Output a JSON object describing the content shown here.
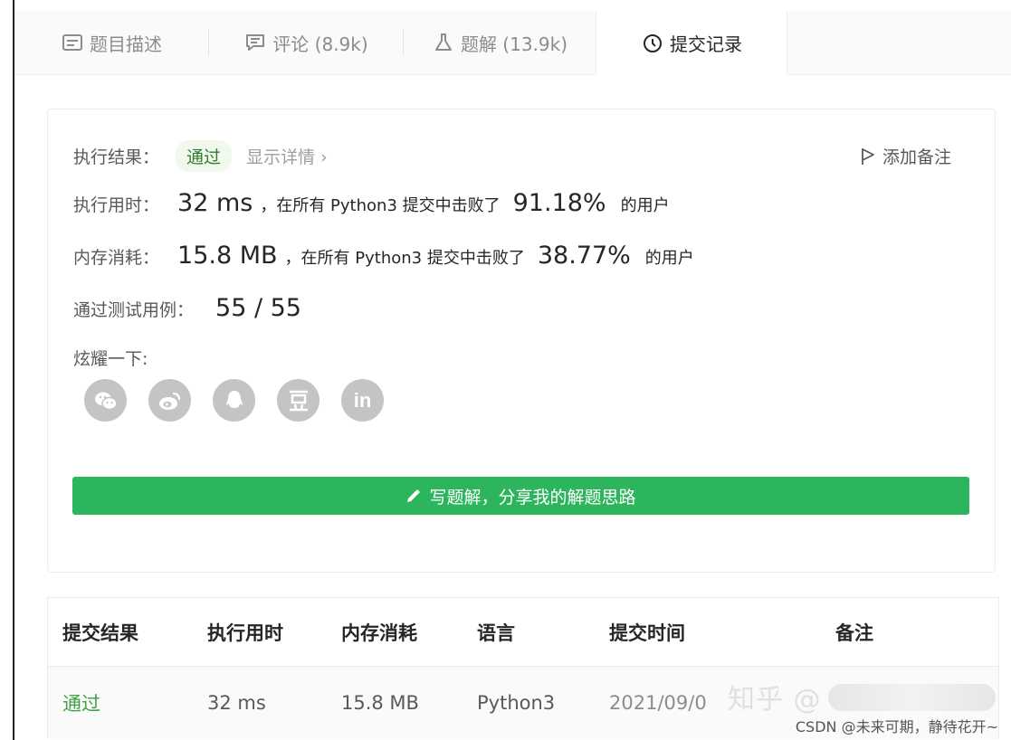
{
  "tabs": [
    {
      "label": "题目描述",
      "icon": "description-icon"
    },
    {
      "label": "评论 (8.9k)",
      "icon": "comment-icon"
    },
    {
      "label": "题解 (13.9k)",
      "icon": "flask-icon"
    },
    {
      "label": "提交记录",
      "icon": "clock-icon",
      "active": true
    }
  ],
  "result": {
    "status_label": "执行结果：",
    "status": "通过",
    "detail": "显示详情 ›",
    "add_note": "添加备注",
    "runtime_label": "执行用时：",
    "runtime": "32 ms",
    "runtime_text": "，在所有 Python3 提交中击败了",
    "runtime_pct": "91.18%",
    "users": "的用户",
    "memory_label": "内存消耗：",
    "memory": "15.8 MB",
    "memory_text": "，在所有 Python3 提交中击败了",
    "memory_pct": "38.77%",
    "tests_label": "通过测试用例：",
    "tests": "55 / 55",
    "share_label": "炫耀一下:",
    "write_solution": "写题解，分享我的解题思路"
  },
  "share_icons": [
    "wechat-icon",
    "weibo-icon",
    "qq-icon",
    "douban-icon",
    "linkedin-icon"
  ],
  "table": {
    "headers": [
      "提交结果",
      "执行用时",
      "内存消耗",
      "语言",
      "提交时间",
      "备注"
    ],
    "rows": [
      [
        "通过",
        "32 ms",
        "15.8 MB",
        "Python3",
        "2021/09/0",
        ""
      ]
    ]
  },
  "watermark": {
    "zhihu": "知乎 @",
    "csdn": "CSDN @未来可期，静待花开~"
  },
  "colors": {
    "accent": "#2db55d",
    "pass": "#43a047"
  }
}
